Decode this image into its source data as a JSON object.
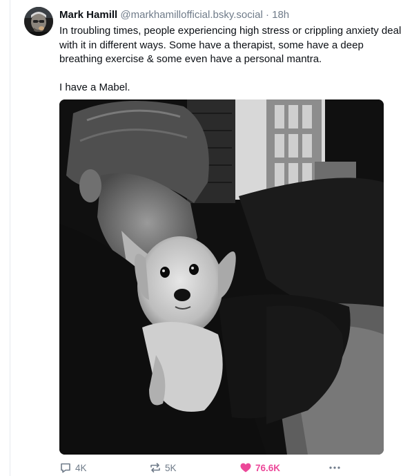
{
  "post": {
    "author": {
      "display_name": "Mark Hamill",
      "handle": "@markhamillofficial.bsky.social",
      "separator": "·",
      "time": "18h"
    },
    "text": {
      "paragraph_1": "In troubling times, people experiencing high stress or crippling anxiety deal with it in different ways. Some have a therapist, some have a deep breathing exercise & some even have a personal mantra.",
      "paragraph_2": "I have a Mabel."
    },
    "image": {
      "description": "Black-and-white photo of a man kissing a small fluffy dog he is holding"
    },
    "actions": {
      "replies": "4K",
      "reposts": "5K",
      "likes": "76.6K",
      "liked": true
    }
  },
  "colors": {
    "text": "#0b0f14",
    "muted": "#6f7b89",
    "like": "#ec4899",
    "divider": "#e6e9ee"
  },
  "icons": [
    "avatar",
    "reply-icon",
    "repost-icon",
    "heart-icon",
    "more-icon"
  ]
}
